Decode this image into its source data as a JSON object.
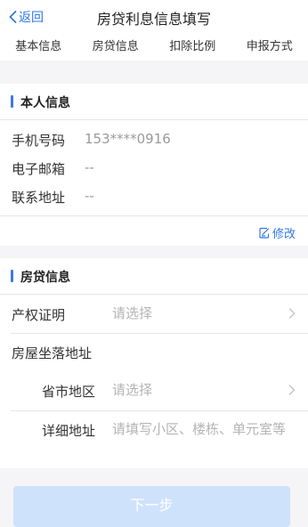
{
  "nav": {
    "back_label": "返回",
    "title": "房贷利息信息填写"
  },
  "steps": [
    "基本信息",
    "房贷信息",
    "扣除比例",
    "申报方式"
  ],
  "personal": {
    "section_title": "本人信息",
    "rows": [
      {
        "label": "手机号码",
        "value": "153****0916"
      },
      {
        "label": "电子邮箱",
        "value": "--"
      },
      {
        "label": "联系地址",
        "value": "--"
      }
    ],
    "edit_label": "修改"
  },
  "loan": {
    "section_title": "房贷信息",
    "property_cert": {
      "label": "产权证明",
      "placeholder": "请选择"
    },
    "address_heading": "房屋坐落地址",
    "region": {
      "label": "省市地区",
      "placeholder": "请选择"
    },
    "detail": {
      "label": "详细地址",
      "placeholder": "请填写小区、楼栋、单元室等"
    }
  },
  "footer": {
    "next_label": "下一步"
  },
  "colors": {
    "accent": "#2f78e6",
    "next_button_disabled": "#cfe2fb"
  }
}
